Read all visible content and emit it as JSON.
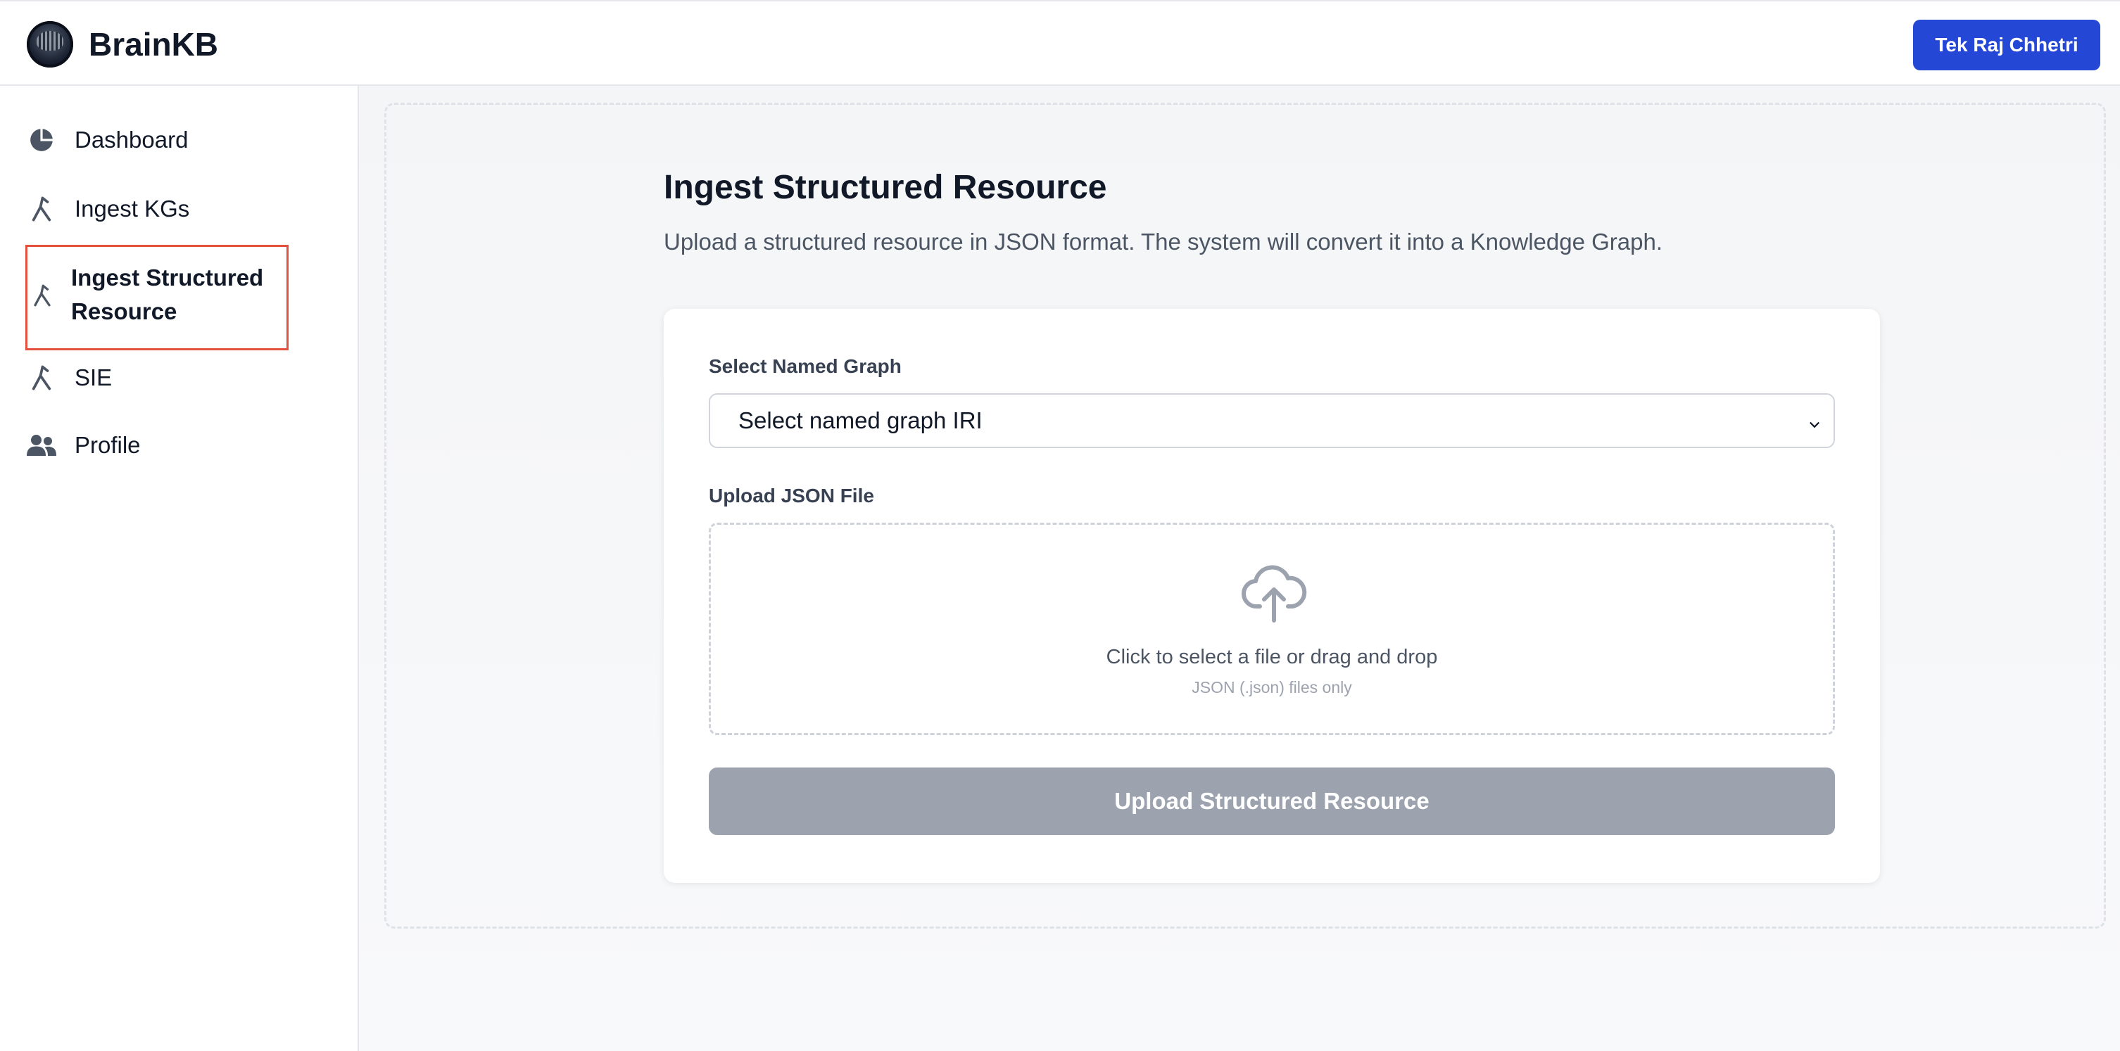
{
  "header": {
    "brand": "BrainKB",
    "user_button": "Tek Raj Chhetri"
  },
  "sidebar": {
    "items": [
      {
        "label": "Dashboard",
        "icon": "pie-chart-icon"
      },
      {
        "label": "Ingest KGs",
        "icon": "ingest-icon"
      },
      {
        "label": "Ingest Structured Resource",
        "icon": "ingest-icon",
        "active": true
      },
      {
        "label": "SIE",
        "icon": "ingest-icon"
      },
      {
        "label": "Profile",
        "icon": "users-icon"
      }
    ]
  },
  "main": {
    "title": "Ingest Structured Resource",
    "description": "Upload a structured resource in JSON format. The system will convert it into a Knowledge Graph.",
    "form": {
      "named_graph_label": "Select Named Graph",
      "named_graph_value": "Select named graph IRI",
      "upload_label": "Upload JSON File",
      "drop_main": "Click to select a file or drag and drop",
      "drop_sub": "JSON (.json) files only",
      "submit": "Upload Structured Resource"
    }
  },
  "colors": {
    "accent": "#2447d6",
    "active_border": "#e2513c",
    "disabled_button": "#9ca3af"
  }
}
